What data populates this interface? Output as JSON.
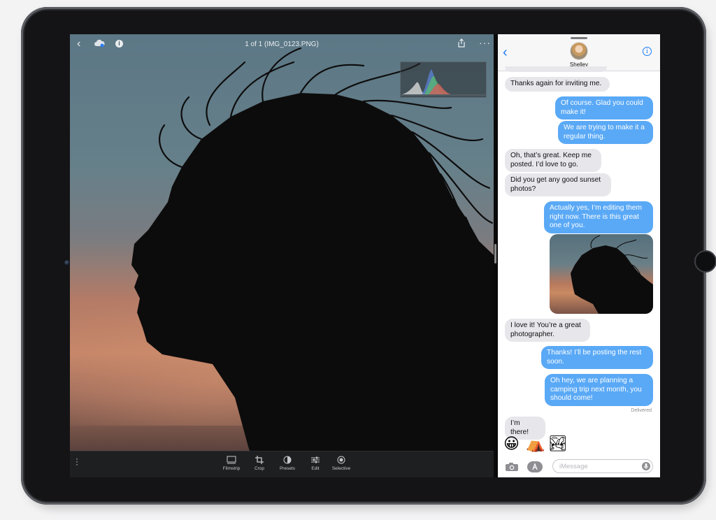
{
  "photo_app": {
    "title": "1 of 1 (IMG_0123.PNG)",
    "back_icon": "chevron-left",
    "cloud_icon": "cloud-sync-icon",
    "info_icon": "i",
    "share_icon": "share-icon",
    "more_icon": "···",
    "toolbar": [
      {
        "label": "Filmstrip",
        "icon": "filmstrip-icon"
      },
      {
        "label": "Crop",
        "icon": "crop-icon"
      },
      {
        "label": "Presets",
        "icon": "presets-icon"
      },
      {
        "label": "Edit",
        "icon": "sliders-icon"
      },
      {
        "label": "Selective",
        "icon": "selective-icon"
      }
    ]
  },
  "messages": {
    "contact_name": "Shelley",
    "back_glyph": "‹",
    "info_glyph": "i",
    "bubbles": [
      {
        "dir": "in",
        "text": "Thanks again for inviting me."
      },
      {
        "dir": "out",
        "text": "Of course. Glad you could make it!"
      },
      {
        "dir": "out",
        "text": "We are trying to make it a regular thing."
      },
      {
        "dir": "in",
        "text": "Oh, that’s great. Keep me posted. I’d love to go."
      },
      {
        "dir": "in",
        "text": "Did you get any good sunset photos?"
      },
      {
        "dir": "out",
        "text": "Actually yes, I’m editing them right now. There is this great one of you."
      },
      {
        "dir": "in",
        "text": "I love it! You’re a great photographer."
      },
      {
        "dir": "out",
        "text": "Thanks! I’ll be posting the rest soon."
      },
      {
        "dir": "out",
        "text": "Oh hey, we are planning a camping trip next month, you should come!"
      },
      {
        "dir": "in",
        "text": "I’m there!"
      }
    ],
    "delivered_label": "Delivered",
    "emojis": [
      "😀",
      "⛺",
      "🏞"
    ],
    "input_placeholder": "iMessage"
  }
}
